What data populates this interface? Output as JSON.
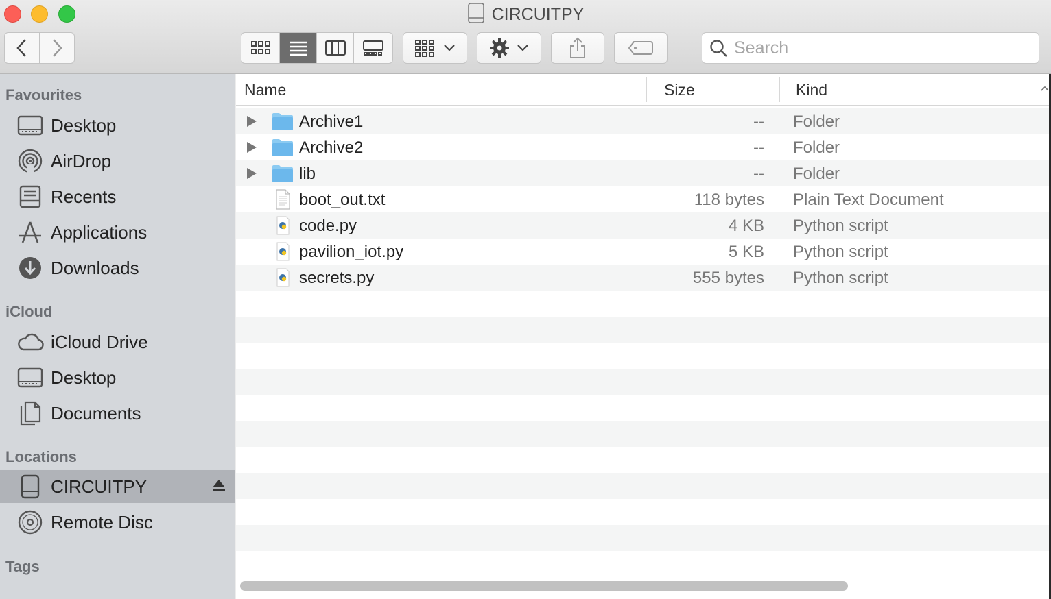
{
  "window": {
    "title": "CIRCUITPY"
  },
  "toolbar": {
    "back_icon": "chevron-left-icon",
    "forward_icon": "chevron-right-icon",
    "view_modes": [
      "icon-view",
      "list-view",
      "column-view",
      "gallery-view"
    ],
    "active_view": "list-view",
    "search": {
      "placeholder": "Search",
      "value": ""
    }
  },
  "sidebar": {
    "sections": [
      {
        "heading": "Favourites",
        "items": [
          {
            "label": "Desktop",
            "icon": "desktop-icon"
          },
          {
            "label": "AirDrop",
            "icon": "airdrop-icon"
          },
          {
            "label": "Recents",
            "icon": "recents-icon"
          },
          {
            "label": "Applications",
            "icon": "applications-icon"
          },
          {
            "label": "Downloads",
            "icon": "downloads-icon"
          }
        ]
      },
      {
        "heading": "iCloud",
        "items": [
          {
            "label": "iCloud Drive",
            "icon": "icloud-icon"
          },
          {
            "label": "Desktop",
            "icon": "desktop-icon"
          },
          {
            "label": "Documents",
            "icon": "documents-icon"
          }
        ]
      },
      {
        "heading": "Locations",
        "items": [
          {
            "label": "CIRCUITPY",
            "icon": "drive-icon",
            "selected": true
          },
          {
            "label": "Remote Disc",
            "icon": "disc-icon"
          }
        ]
      },
      {
        "heading": "Tags",
        "items": []
      }
    ]
  },
  "columns": {
    "name": "Name",
    "size": "Size",
    "kind": "Kind"
  },
  "files": [
    {
      "name": "Archive1",
      "size": "--",
      "kind": "Folder",
      "type": "folder"
    },
    {
      "name": "Archive2",
      "size": "--",
      "kind": "Folder",
      "type": "folder"
    },
    {
      "name": "lib",
      "size": "--",
      "kind": "Folder",
      "type": "folder"
    },
    {
      "name": "boot_out.txt",
      "size": "118 bytes",
      "kind": "Plain Text Document",
      "type": "text"
    },
    {
      "name": "code.py",
      "size": "4 KB",
      "kind": "Python script",
      "type": "python"
    },
    {
      "name": "pavilion_iot.py",
      "size": "5 KB",
      "kind": "Python script",
      "type": "python"
    },
    {
      "name": "secrets.py",
      "size": "555 bytes",
      "kind": "Python script",
      "type": "python"
    }
  ]
}
